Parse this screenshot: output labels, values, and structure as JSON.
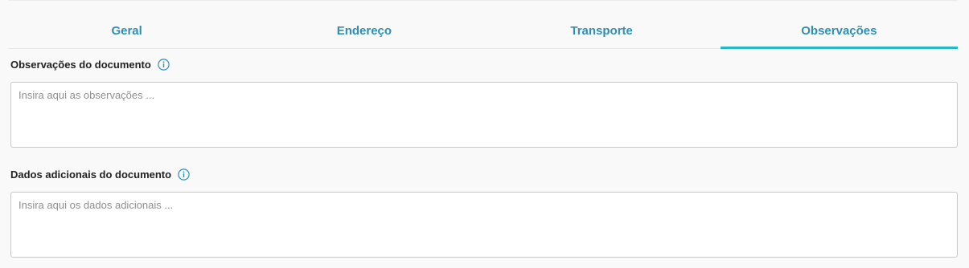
{
  "tabs": [
    {
      "label": "Geral",
      "active": false
    },
    {
      "label": "Endereço",
      "active": false
    },
    {
      "label": "Transporte",
      "active": false
    },
    {
      "label": "Observações",
      "active": true
    }
  ],
  "observacoes": {
    "label": "Observações do documento",
    "info_icon": "info-icon",
    "placeholder": "Insira aqui as observações ...",
    "value": ""
  },
  "dados_adicionais": {
    "label": "Dados adicionais do documento",
    "info_icon": "info-icon",
    "placeholder": "Insira aqui os dados adicionais ...",
    "value": ""
  },
  "colors": {
    "tab_text": "#2f8fb3",
    "tab_active_underline": "#29b6c5",
    "info_icon": "#2f8fb3"
  }
}
